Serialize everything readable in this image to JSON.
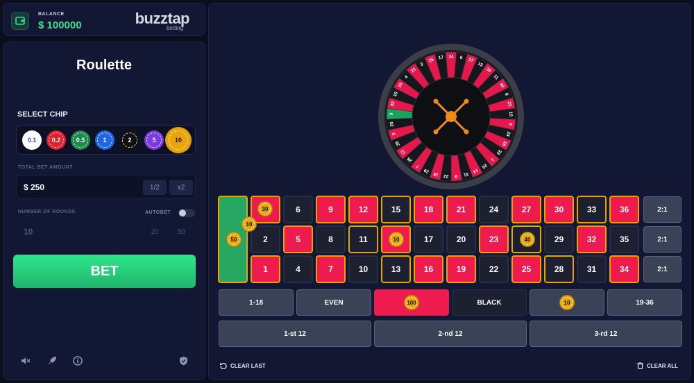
{
  "balance": {
    "label": "BALANCE",
    "value": "$ 100000"
  },
  "brand": {
    "name": "buzztap",
    "sub": "betting"
  },
  "game": {
    "title": "Roulette"
  },
  "chips": {
    "label": "SELECT CHIP",
    "items": [
      {
        "value": "0.1",
        "color": "#ffffff",
        "text": "#2450d6"
      },
      {
        "value": "0.2",
        "color": "#e0202c",
        "text": "#ffffff"
      },
      {
        "value": "0.5",
        "color": "#1b8a4f",
        "text": "#ffffff"
      },
      {
        "value": "1",
        "color": "#1f66e6",
        "text": "#ffffff"
      },
      {
        "value": "2",
        "color": "#111111",
        "text": "#ffffff"
      },
      {
        "value": "5",
        "color": "#7a3be0",
        "text": "#ffffff"
      },
      {
        "value": "10",
        "color": "#eaa50c",
        "text": "#1a1200"
      }
    ]
  },
  "total_bet": {
    "label": "TOTAL BET AMOUNT",
    "value": "$ 250",
    "half": "1/2",
    "double": "x2"
  },
  "rounds": {
    "label": "NUMBER OF ROUNDS",
    "autobet": "AUTOBET",
    "value": "10",
    "opt1": "20",
    "opt2": "50"
  },
  "bet_button": "BET",
  "wheel": {
    "numbers": [
      "0",
      "32",
      "15",
      "19",
      "4",
      "21",
      "2",
      "25",
      "17",
      "34",
      "6",
      "27",
      "13",
      "36",
      "11",
      "30",
      "8",
      "23",
      "10",
      "5",
      "24",
      "16",
      "33",
      "1",
      "20",
      "14",
      "31",
      "9",
      "22",
      "18",
      "29",
      "7",
      "28",
      "12",
      "35",
      "3",
      "26"
    ]
  },
  "table": {
    "zero": "0",
    "rows": [
      [
        "3",
        "6",
        "9",
        "12",
        "15",
        "18",
        "21",
        "24",
        "27",
        "30",
        "33",
        "36"
      ],
      [
        "2",
        "5",
        "8",
        "11",
        "14",
        "17",
        "20",
        "23",
        "26",
        "29",
        "32",
        "35"
      ],
      [
        "1",
        "4",
        "7",
        "10",
        "13",
        "16",
        "19",
        "22",
        "25",
        "28",
        "31",
        "34"
      ]
    ],
    "columns": [
      "2:1",
      "2:1",
      "2:1"
    ],
    "outside": [
      "1-18",
      "EVEN",
      "RED",
      "BLACK",
      "ODD",
      "19-36"
    ],
    "dozens": [
      "1-st 12",
      "2-nd 12",
      "3-rd 12"
    ],
    "chips": {
      "zero": "50",
      "n3": "30",
      "split": "10",
      "n14": "10",
      "n26": "40",
      "red": "100",
      "odd": "10"
    }
  },
  "actions": {
    "clear_last": "CLEAR LAST",
    "clear_all": "CLEAR ALL"
  }
}
